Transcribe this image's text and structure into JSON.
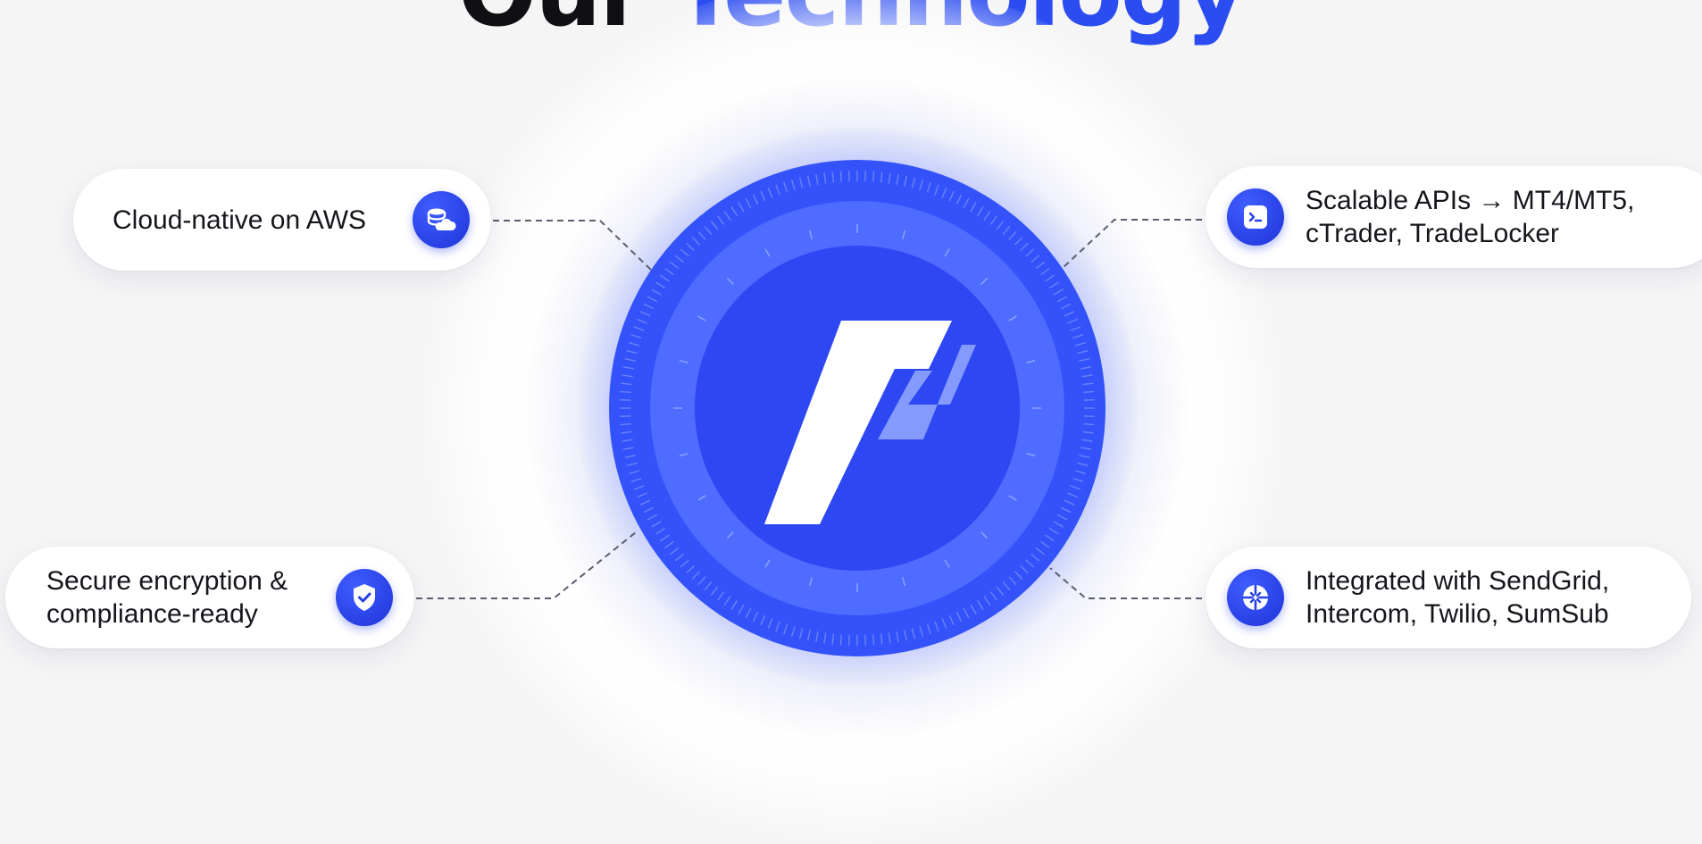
{
  "heading": {
    "word1": "Our",
    "word2": "Technology"
  },
  "colors": {
    "accent": "#2b4cf0",
    "dial": "#2f4df7",
    "connector": "#5b5e6e"
  },
  "features": {
    "aws": {
      "label": "Cloud-native on AWS",
      "icon": "database-cloud-icon"
    },
    "security": {
      "label": "Secure encryption &\ncompliance-ready",
      "icon": "shield-check-icon"
    },
    "apis": {
      "label": "Scalable APIs → MT4/MT5,\ncTrader, TradeLocker",
      "icon": "terminal-icon"
    },
    "integrations": {
      "label": "Integrated with SendGrid,\nIntercom, Twilio, SumSub",
      "icon": "integration-hub-icon"
    }
  }
}
